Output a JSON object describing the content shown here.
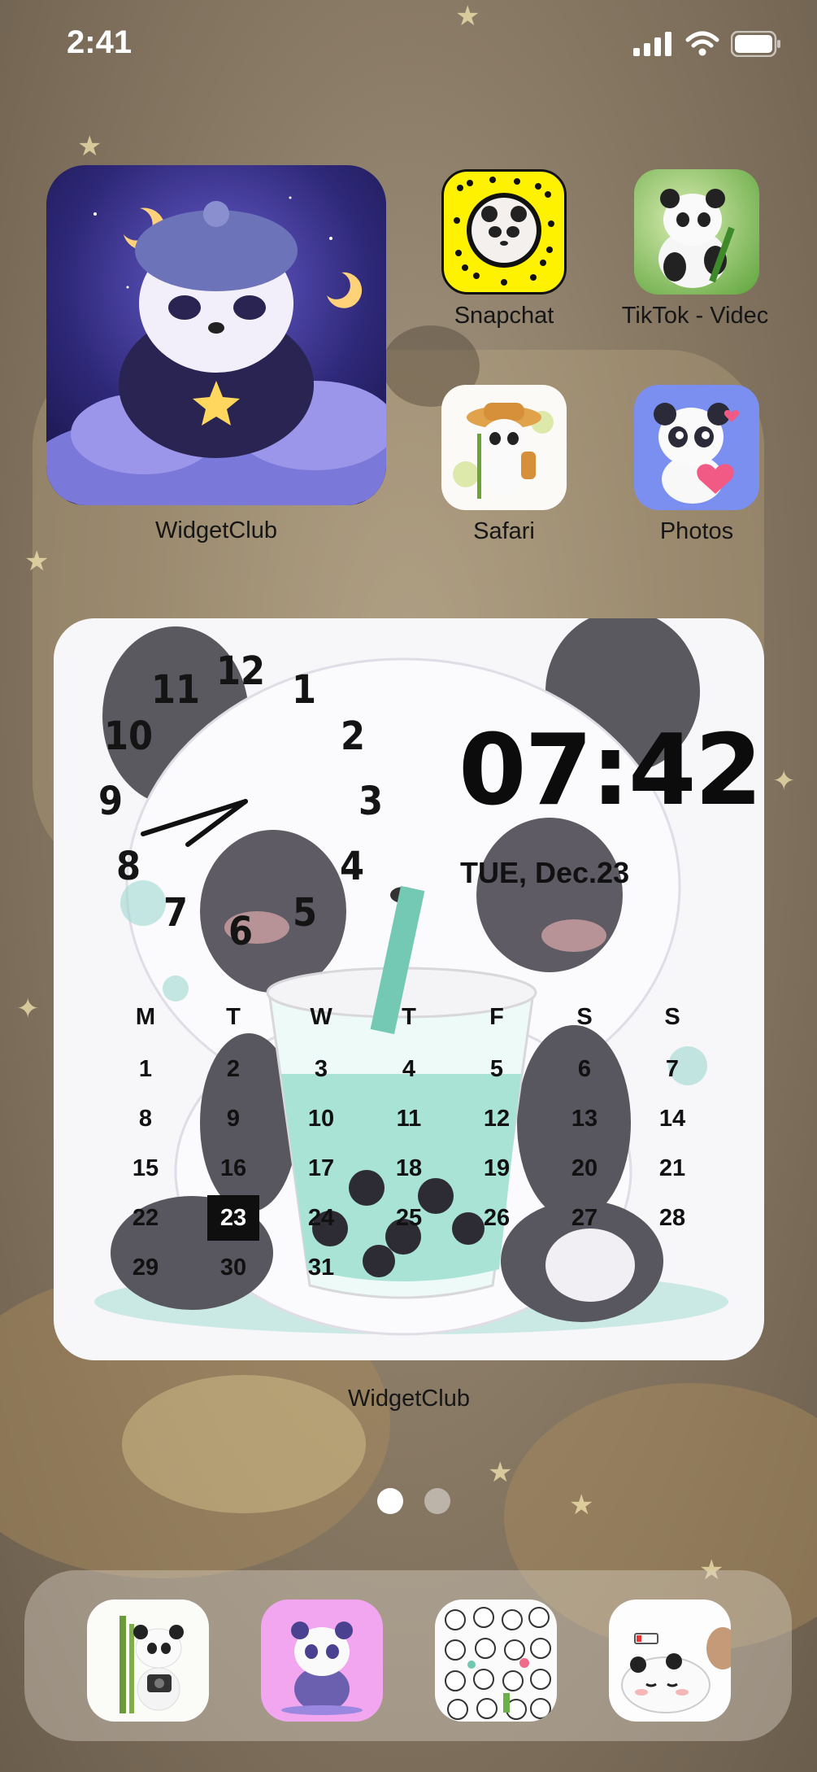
{
  "status_bar": {
    "time": "2:41"
  },
  "apps": {
    "widgetclub_large": "WidgetClub",
    "snapchat": "Snapchat",
    "tiktok": "TikTok - Videc",
    "safari": "Safari",
    "photos": "Photos"
  },
  "clock_widget": {
    "label": "WidgetClub",
    "digital_time": "07:42",
    "date": "TUE, Dec.23",
    "dial_numbers": [
      "12",
      "1",
      "2",
      "3",
      "4",
      "5",
      "6",
      "7",
      "8",
      "9",
      "10",
      "11"
    ],
    "weekdays": [
      "M",
      "T",
      "W",
      "T",
      "F",
      "S",
      "S"
    ],
    "weeks": [
      [
        "1",
        "2",
        "3",
        "4",
        "5",
        "6",
        "7"
      ],
      [
        "8",
        "9",
        "10",
        "11",
        "12",
        "13",
        "14"
      ],
      [
        "15",
        "16",
        "17",
        "18",
        "19",
        "20",
        "21"
      ],
      [
        "22",
        "23",
        "24",
        "25",
        "26",
        "27",
        "28"
      ],
      [
        "29",
        "30",
        "31",
        "",
        "",
        "",
        ""
      ]
    ],
    "today": "23"
  },
  "page_indicator": {
    "pages": 2,
    "current": 1
  },
  "dock": {
    "icons": [
      "panda-camera-icon",
      "panda-purple-icon",
      "panda-sticker-grid-icon",
      "panda-sleeping-icon"
    ]
  },
  "colors": {
    "snapchat_yellow": "#fff200",
    "photos_blue": "#7b8ff0",
    "dock_purple": "#f2a6f0",
    "today_bg": "#0f0f0f"
  }
}
